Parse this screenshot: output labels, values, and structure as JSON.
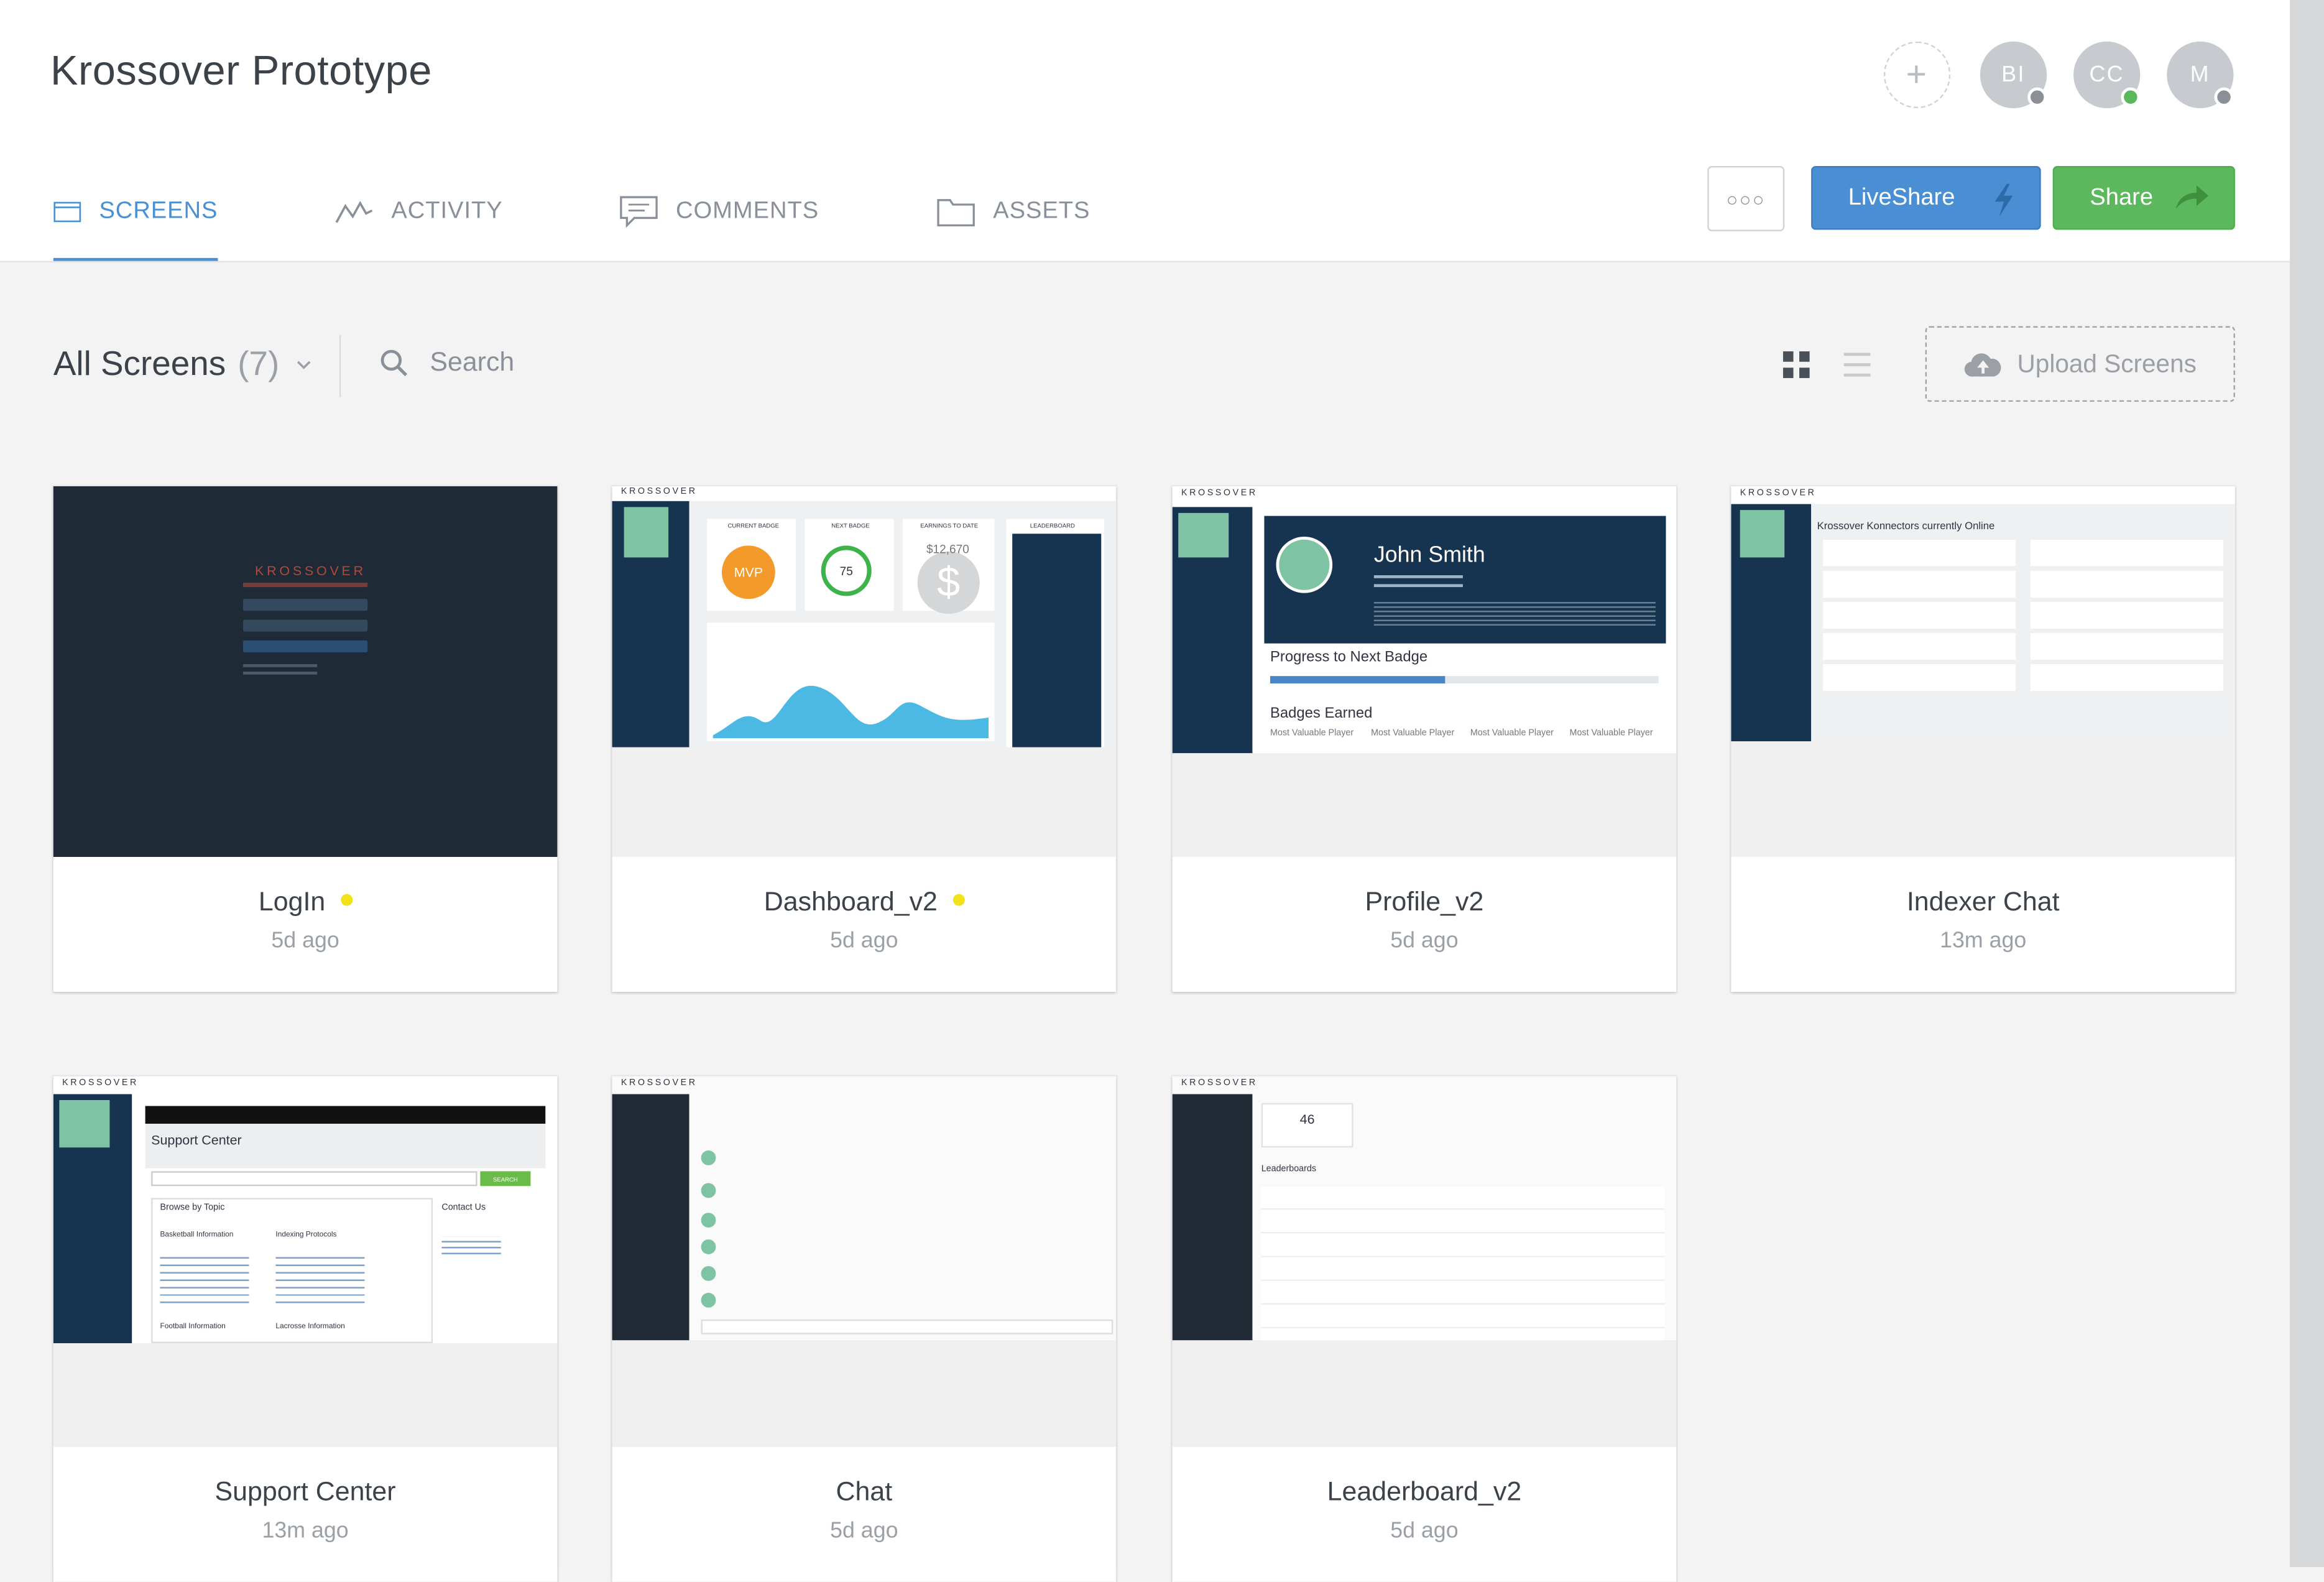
{
  "app": {
    "title": "Krossover Prototype"
  },
  "collaborators": [
    {
      "initials": "+",
      "kind": "add"
    },
    {
      "initials": "BI",
      "status": "#8b9096"
    },
    {
      "initials": "CC",
      "status": "#5cb85c"
    },
    {
      "initials": "M",
      "status": "#8b9096"
    }
  ],
  "tabs": [
    {
      "label": "SCREENS",
      "icon": "screens-icon",
      "active": true
    },
    {
      "label": "ACTIVITY",
      "icon": "activity-icon",
      "active": false
    },
    {
      "label": "COMMENTS",
      "icon": "comments-icon",
      "active": false
    },
    {
      "label": "ASSETS",
      "icon": "folder-icon",
      "active": false
    }
  ],
  "actions": {
    "more": "○○○",
    "liveshare": "LiveShare",
    "share": "Share"
  },
  "toolbar": {
    "filter_label": "All Screens",
    "filter_count": "(7)",
    "search_placeholder": "Search",
    "upload_label": "Upload Screens",
    "view": "grid"
  },
  "screens": [
    {
      "name": "LogIn",
      "time": "5d ago",
      "unread": true
    },
    {
      "name": "Dashboard_v2",
      "time": "5d ago",
      "unread": true
    },
    {
      "name": "Profile_v2",
      "time": "5d ago",
      "unread": false
    },
    {
      "name": "Indexer Chat",
      "time": "13m ago",
      "unread": false
    },
    {
      "name": "Support Center",
      "time": "13m ago",
      "unread": false
    },
    {
      "name": "Chat",
      "time": "5d ago",
      "unread": false
    },
    {
      "name": "Leaderboard_v2",
      "time": "5d ago",
      "unread": false
    }
  ],
  "thumbs": {
    "brand": "KROSSOVER",
    "dashboard": {
      "badge1": "CURRENT BADGE",
      "badge2": "NEXT BADGE",
      "badge3": "EARNINGS TO DATE",
      "lead": "LEADERBOARD",
      "mvp": "MVP",
      "pct": "75",
      "money": "$12,670"
    },
    "profile": {
      "name": "John Smith",
      "progress": "Progress to Next Badge",
      "badges": "Badges Earned",
      "mvp": "Most Valuable Player"
    },
    "indexer": {
      "heading": "Krossover Konnectors currently Online"
    },
    "support": {
      "heading": "Support Center",
      "topic": "Browse by Topic",
      "contact": "Contact Us",
      "basketball": "Basketball Information",
      "indexing": "Indexing Protocols",
      "football": "Football Information",
      "lacrosse": "Lacrosse Information",
      "search_btn": "SEARCH"
    },
    "leader": {
      "num": "46",
      "heading": "Leaderboards"
    }
  }
}
